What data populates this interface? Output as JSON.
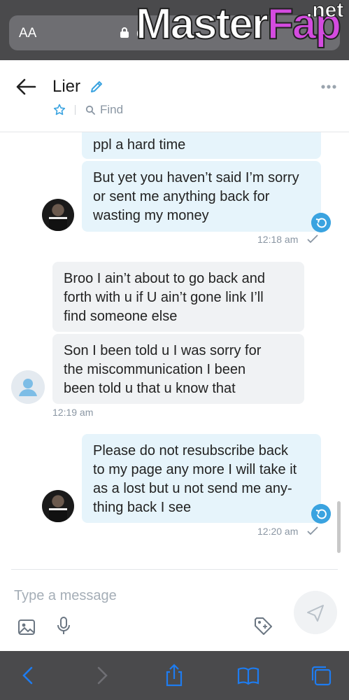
{
  "browser": {
    "text_size_label": "AA",
    "url_partial": "o",
    "watermark_main": "Master",
    "watermark_accent": "Fap",
    "watermark_tld": ".net"
  },
  "header": {
    "title": "Lier",
    "find_label": "Find"
  },
  "messages": [
    {
      "direction": "sent",
      "lines": [
        "ppl a hard time"
      ]
    },
    {
      "direction": "sent",
      "lines": [
        "But yet you haven’t said I’m sorry",
        "or sent me anything back for",
        "wasting my money"
      ],
      "time": "12:18 am"
    },
    {
      "direction": "received",
      "lines": [
        "Broo I ain’t about to go back and",
        "forth with u if U ain’t gone link I’ll",
        "find someone else"
      ]
    },
    {
      "direction": "received",
      "lines": [
        "Son I been told u I was sorry for",
        "the miscommunication I been",
        "been told u that u know that"
      ],
      "time": "12:19 am"
    },
    {
      "direction": "sent",
      "lines": [
        "Please do not resubscribe back",
        "to my page any more I will take it",
        "as a lost but u not send me any-",
        "thing back I see"
      ],
      "time": "12:20 am"
    }
  ],
  "composer": {
    "placeholder": "Type a message"
  },
  "icons": {
    "back": "arrow-left-icon",
    "edit": "pencil-icon",
    "more": "ellipsis-icon",
    "star": "star-icon",
    "find": "search-icon",
    "image": "image-icon",
    "mic": "microphone-icon",
    "price": "price-tag-icon",
    "send": "send-icon",
    "reply": "reply-icon",
    "check": "check-icon"
  },
  "colors": {
    "accent": "#3aa3e0",
    "sent_bubble": "#e6f4fb",
    "received_bubble": "#f0f2f4",
    "browser_chrome": "#4a4a4c",
    "browser_icons": "#1e7cf0"
  }
}
